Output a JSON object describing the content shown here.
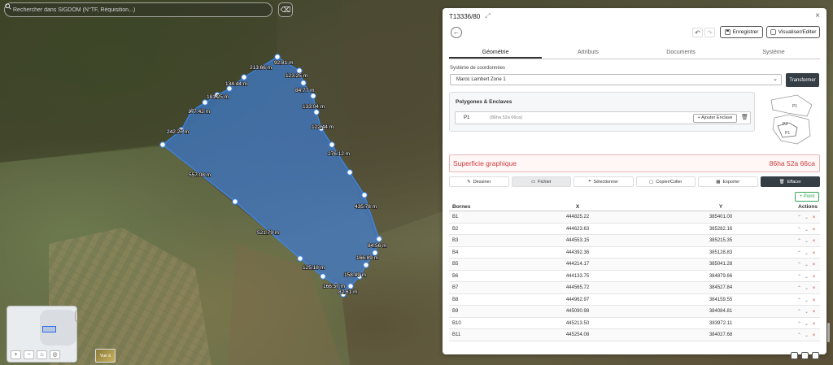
{
  "map": {
    "search_placeholder": "Rechercher dans SIGDOM (N°TF, Réquisition...)",
    "clear_label": "⌫",
    "basemap_label": "Vue à",
    "minimap_tools": [
      "+",
      "−",
      "⌂",
      "◎"
    ],
    "compass": "↑",
    "segments": [
      {
        "label": "92.81 m"
      },
      {
        "label": "213.66 m"
      },
      {
        "label": "134.44 m"
      },
      {
        "label": "181.25 m"
      },
      {
        "label": "177.42 m"
      },
      {
        "label": "242.27 m"
      },
      {
        "label": "557.08 m"
      },
      {
        "label": "521.79 m"
      },
      {
        "label": "125.18 m"
      },
      {
        "label": "166.57 m"
      },
      {
        "label": "82.61 m"
      },
      {
        "label": "158.49 m"
      },
      {
        "label": "166.89 m"
      },
      {
        "label": "84.56 m"
      },
      {
        "label": "435.78 m"
      },
      {
        "label": "276.12 m"
      },
      {
        "label": "122.44 m"
      },
      {
        "label": "133.04 m"
      },
      {
        "label": "84.77 m"
      },
      {
        "label": "123.25 m"
      }
    ]
  },
  "panel": {
    "title": "T13336/80",
    "close": "×",
    "expand": "⤢",
    "toolbar": {
      "back": "←",
      "undo": "↶",
      "redo": "↷",
      "save_label": "Enregistrer",
      "view_label": "Visualiser/Editer"
    },
    "tabs": [
      "Géométrie",
      "Attributs",
      "Documents",
      "Système"
    ],
    "coord_label": "Système de coordonnées",
    "coord_value": "Maroc Lambert Zone 1",
    "transform_label": "Transformer",
    "polygons": {
      "title": "Polygones & Enclaves",
      "rows": [
        {
          "id": "P1",
          "area": "(86ha 52a 66ca)"
        }
      ],
      "add_enclave": "+ Ajouter Enclave",
      "thumb_labels": [
        "P1",
        "P3",
        "P1"
      ]
    },
    "surface_label": "Superficie graphique",
    "surface_value": "86ha 52a 66ca",
    "actions": [
      "Dessiner",
      "Fichier",
      "Sélectionner",
      "Copier/Coller",
      "Exporter",
      "Effacer"
    ],
    "add_point": "+ Point",
    "table": {
      "headers": [
        "Bornes",
        "X",
        "Y",
        "Actions"
      ],
      "rows": [
        [
          "B1",
          "444825.22",
          "385401.00"
        ],
        [
          "B2",
          "444623.63",
          "385282.16"
        ],
        [
          "B3",
          "444553.15",
          "385215.35"
        ],
        [
          "B4",
          "444392.36",
          "385128.83"
        ],
        [
          "B5",
          "444214.17",
          "385041.28"
        ],
        [
          "B6",
          "444133.75",
          "384879.66"
        ],
        [
          "B7",
          "444565.72",
          "384527.84"
        ],
        [
          "B8",
          "444962.97",
          "384159.55"
        ],
        [
          "B9",
          "445090.98",
          "384084.81"
        ],
        [
          "B10",
          "445213.50",
          "383972.11"
        ],
        [
          "B11",
          "445254.08",
          "384027.68"
        ]
      ],
      "row_actions": [
        "⌃",
        "⌄",
        "×"
      ]
    }
  }
}
